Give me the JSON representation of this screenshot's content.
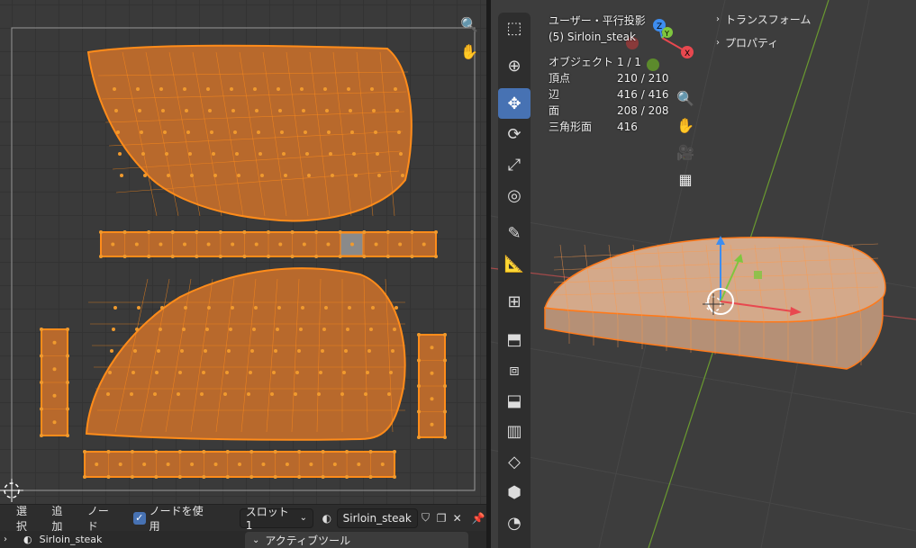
{
  "uv_editor": {
    "header": {
      "menus": [
        "選択",
        "追加",
        "ノード"
      ],
      "use_nodes_label": "ノードを使用",
      "use_nodes_checked": true,
      "slot_label": "スロット1",
      "material_name": "Sirloin_steak"
    },
    "footer": {
      "object_name": "Sirloin_steak",
      "active_tool_label": "アクティブツール"
    }
  },
  "viewport": {
    "view_name": "ユーザー・平行投影",
    "object_label": "(5) Sirloin_steak",
    "stats": [
      {
        "label": "オブジェクト",
        "value": "1 / 1"
      },
      {
        "label": "頂点",
        "value": "210 / 210"
      },
      {
        "label": "辺",
        "value": "416 / 416"
      },
      {
        "label": "面",
        "value": "208 / 208"
      },
      {
        "label": "三角形面",
        "value": "416"
      }
    ],
    "sidebar_tabs": [
      "トランスフォーム",
      "プロパティ"
    ],
    "gizmo_axes": {
      "x": "X",
      "y": "Y",
      "z": "Z"
    }
  },
  "colors": {
    "uv_face": "#b8692c",
    "uv_vertex": "#f09a2e",
    "selected_highlight": "#ff8c1a",
    "active_tool": "#4772b3",
    "axis_x": "#e8484f",
    "axis_y": "#7ec63e",
    "axis_z": "#3d8df0"
  }
}
